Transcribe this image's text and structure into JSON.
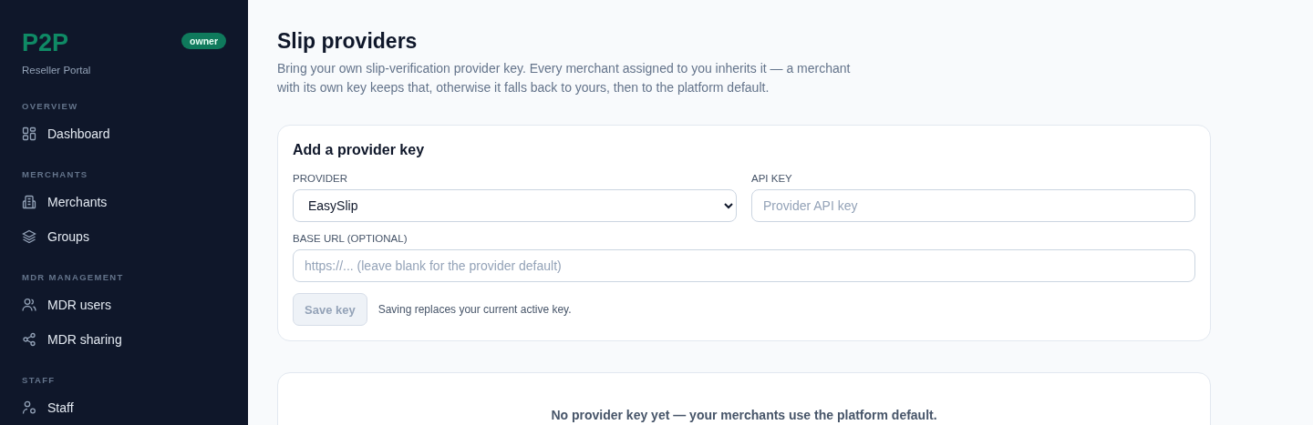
{
  "sidebar": {
    "brand": "P2P",
    "role_badge": "owner",
    "subtitle": "Reseller Portal",
    "sections": [
      {
        "heading": "OVERVIEW",
        "items": [
          {
            "label": "Dashboard",
            "kind": "grid"
          }
        ]
      },
      {
        "heading": "MERCHANTS",
        "items": [
          {
            "label": "Merchants",
            "kind": "building"
          },
          {
            "label": "Groups",
            "kind": "layers"
          }
        ]
      },
      {
        "heading": "MDR MANAGEMENT",
        "items": [
          {
            "label": "MDR users",
            "kind": "users"
          },
          {
            "label": "MDR sharing",
            "kind": "share"
          }
        ]
      },
      {
        "heading": "STAFF",
        "items": [
          {
            "label": "Staff",
            "kind": "staff"
          }
        ]
      }
    ]
  },
  "page": {
    "title": "Slip providers",
    "description": "Bring your own slip-verification provider key. Every merchant assigned to you inherits it — a merchant with its own key keeps that, otherwise it falls back to yours, then to the platform default."
  },
  "form": {
    "title": "Add a provider key",
    "provider": {
      "label": "PROVIDER",
      "value": "EasySlip"
    },
    "api_key": {
      "label": "API KEY",
      "placeholder": "Provider API key"
    },
    "base_url": {
      "label": "BASE URL (OPTIONAL)",
      "placeholder": "https://... (leave blank for the provider default)"
    },
    "save_button": {
      "label": "Save key",
      "disabled": true
    },
    "hint": "Saving replaces your current active key."
  },
  "empty_state": {
    "message": "No provider key yet — your merchants use the platform default."
  }
}
